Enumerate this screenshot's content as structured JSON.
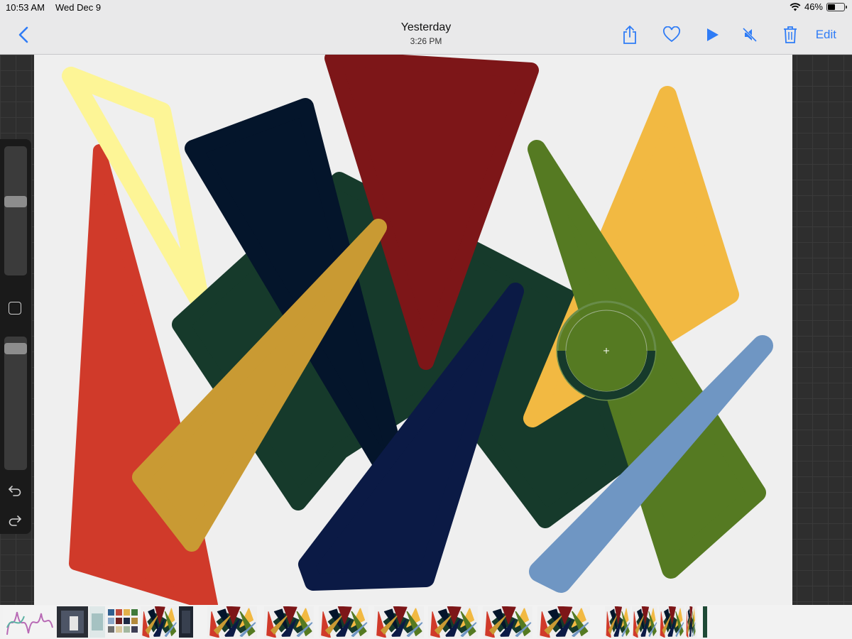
{
  "status_bar": {
    "time": "10:53 AM",
    "date": "Wed Dec 9",
    "battery": "46%",
    "battery_level": 0.46,
    "wifi_icon": "wifi-icon",
    "battery_icon": "battery-icon"
  },
  "nav": {
    "back_icon": "chevron-left-icon",
    "title": "Yesterday",
    "subtitle": "3:26 PM",
    "share_icon": "share-icon",
    "favorite_icon": "heart-icon",
    "play_icon": "play-icon",
    "mute_icon": "speaker-muted-icon",
    "delete_icon": "trash-icon",
    "edit_label": "Edit",
    "accent_color": "#2f7cf6"
  },
  "sidebar": {
    "brush_size_level": 0.42,
    "opacity_level": 0.05,
    "modify_icon": "square-modify-icon",
    "undo_icon": "undo-icon",
    "redo_icon": "redo-icon"
  },
  "artwork": {
    "shape_colors": {
      "red": "#d03a2a",
      "yellow_light": "#fdf596",
      "dark_green": "#163a2b",
      "navy_black": "#04152b",
      "maroon": "#7d1618",
      "mustard": "#c99a33",
      "orange_yellow": "#f2b942",
      "olive_green": "#557a22",
      "navy_blue": "#0b1a45",
      "light_blue": "#6f96c3"
    },
    "eyedropper": "color-picker-loupe"
  },
  "filmstrip": {
    "thumbnail_count": 18
  }
}
